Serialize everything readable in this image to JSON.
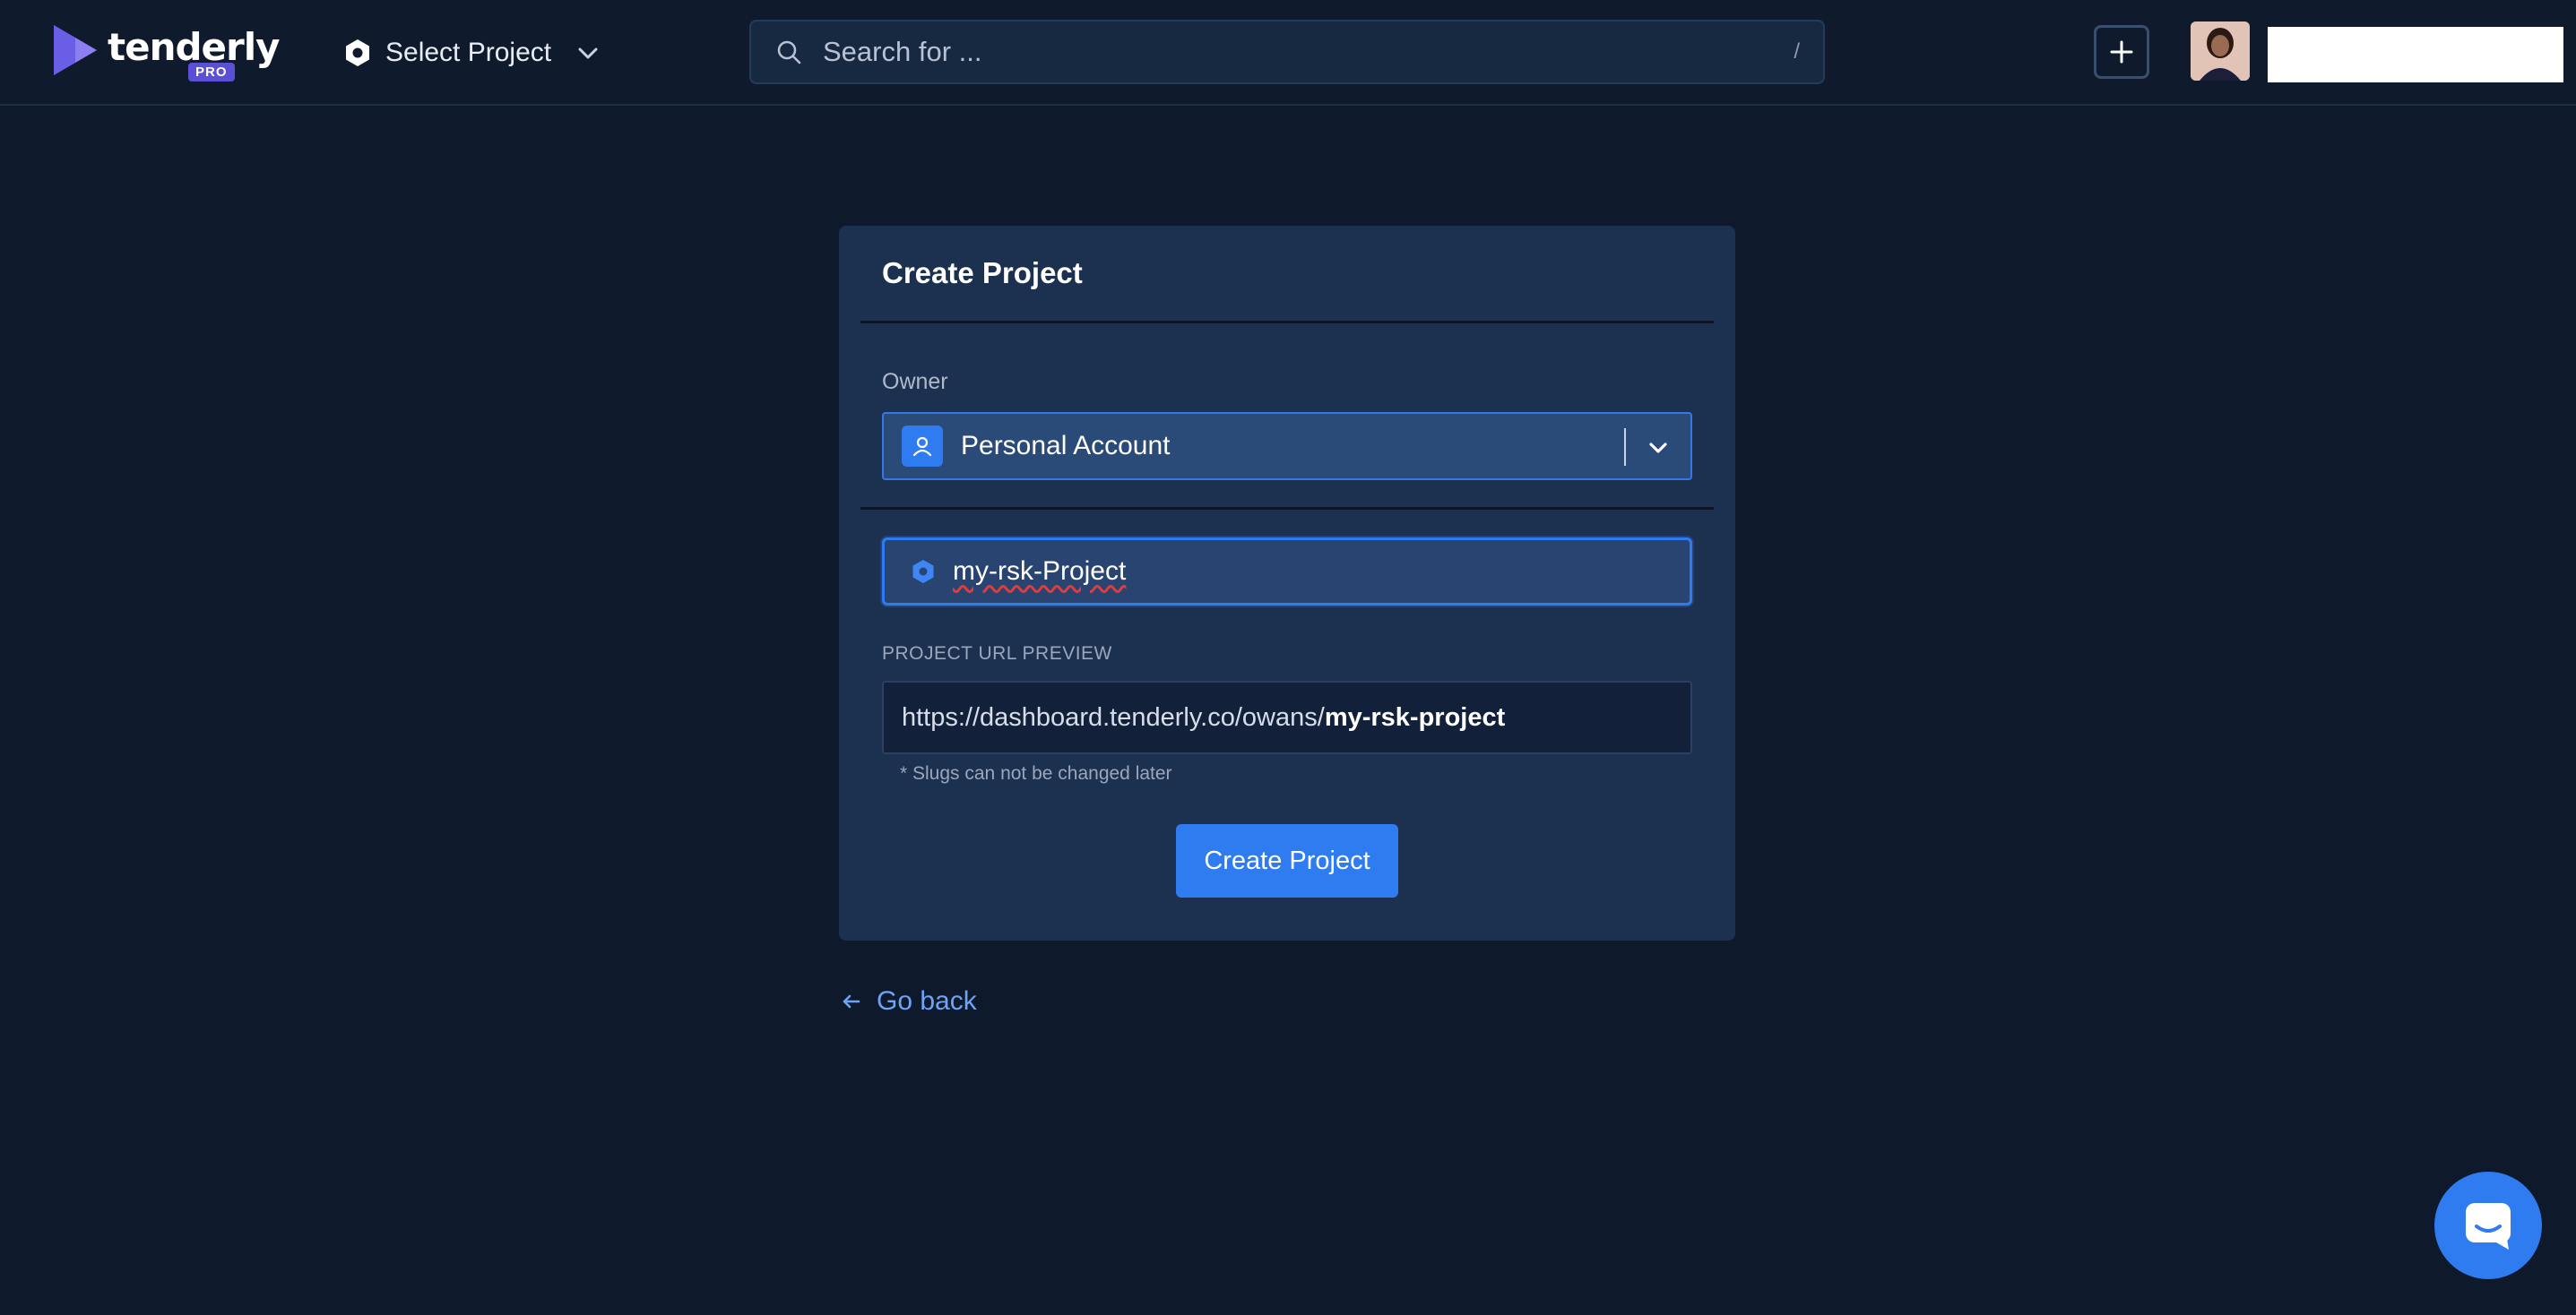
{
  "header": {
    "logo_text": "tenderly",
    "logo_badge": "PRO",
    "project_select_label": "Select Project",
    "search_placeholder": "Search for ...",
    "search_shortcut": "/"
  },
  "form": {
    "title": "Create Project",
    "owner_label": "Owner",
    "owner_value": "Personal Account",
    "project_name_value": "my-rsk-Project",
    "url_preview_label": "PROJECT URL PREVIEW",
    "url_base": "https://dashboard.tenderly.co/owans/",
    "url_slug": "my-rsk-project",
    "slug_note": "* Slugs can not be changed later",
    "submit_label": "Create Project"
  },
  "footer": {
    "go_back_label": "Go back"
  },
  "colors": {
    "background": "#0e1a2b",
    "card": "#1c3050",
    "accent": "#2f7bf0",
    "link": "#6fa3f5"
  },
  "icons": {
    "logo": "tenderly-logo-icon",
    "project": "hexagon-icon",
    "dropdown": "chevron-down-icon",
    "search": "search-icon",
    "add": "plus-icon",
    "owner": "user-icon",
    "back": "arrow-left-icon",
    "chat": "chat-icon"
  }
}
